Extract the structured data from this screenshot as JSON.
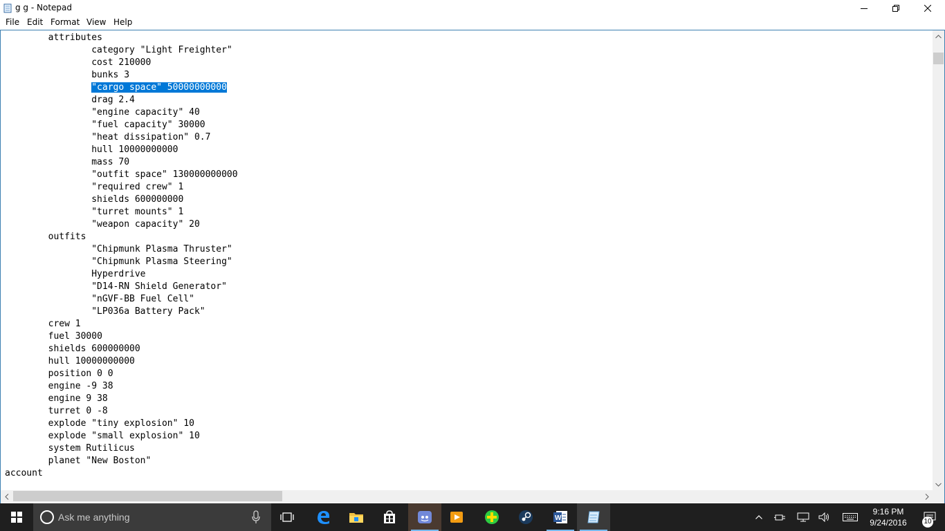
{
  "window": {
    "title": "g g - Notepad",
    "menu": [
      "File",
      "Edit",
      "Format",
      "View",
      "Help"
    ]
  },
  "editor": {
    "lines": [
      {
        "indent": "        ",
        "text": "attributes"
      },
      {
        "indent": "                ",
        "text": "category \"Light Freighter\""
      },
      {
        "indent": "                ",
        "text": "cost 210000"
      },
      {
        "indent": "                ",
        "text": "bunks 3"
      },
      {
        "indent": "                ",
        "text": "\"cargo space\" 50000000000",
        "selected": true
      },
      {
        "indent": "                ",
        "text": "drag 2.4"
      },
      {
        "indent": "                ",
        "text": "\"engine capacity\" 40"
      },
      {
        "indent": "                ",
        "text": "\"fuel capacity\" 30000"
      },
      {
        "indent": "                ",
        "text": "\"heat dissipation\" 0.7"
      },
      {
        "indent": "                ",
        "text": "hull 10000000000"
      },
      {
        "indent": "                ",
        "text": "mass 70"
      },
      {
        "indent": "                ",
        "text": "\"outfit space\" 130000000000"
      },
      {
        "indent": "                ",
        "text": "\"required crew\" 1"
      },
      {
        "indent": "                ",
        "text": "shields 600000000"
      },
      {
        "indent": "                ",
        "text": "\"turret mounts\" 1"
      },
      {
        "indent": "                ",
        "text": "\"weapon capacity\" 20"
      },
      {
        "indent": "        ",
        "text": "outfits"
      },
      {
        "indent": "                ",
        "text": "\"Chipmunk Plasma Thruster\""
      },
      {
        "indent": "                ",
        "text": "\"Chipmunk Plasma Steering\""
      },
      {
        "indent": "                ",
        "text": "Hyperdrive"
      },
      {
        "indent": "                ",
        "text": "\"D14-RN Shield Generator\""
      },
      {
        "indent": "                ",
        "text": "\"nGVF-BB Fuel Cell\""
      },
      {
        "indent": "                ",
        "text": "\"LP036a Battery Pack\""
      },
      {
        "indent": "        ",
        "text": "crew 1"
      },
      {
        "indent": "        ",
        "text": "fuel 30000"
      },
      {
        "indent": "        ",
        "text": "shields 600000000"
      },
      {
        "indent": "        ",
        "text": "hull 10000000000"
      },
      {
        "indent": "        ",
        "text": "position 0 0"
      },
      {
        "indent": "        ",
        "text": "engine -9 38"
      },
      {
        "indent": "        ",
        "text": "engine 9 38"
      },
      {
        "indent": "        ",
        "text": "turret 0 -8"
      },
      {
        "indent": "        ",
        "text": "explode \"tiny explosion\" 10"
      },
      {
        "indent": "        ",
        "text": "explode \"small explosion\" 10"
      },
      {
        "indent": "        ",
        "text": "system Rutilicus"
      },
      {
        "indent": "        ",
        "text": "planet \"New Boston\""
      },
      {
        "indent": "",
        "text": "account"
      }
    ]
  },
  "taskbar": {
    "search_placeholder": "Ask me anything",
    "apps": [
      {
        "name": "task-view",
        "icon": "task-view-icon"
      },
      {
        "name": "edge",
        "icon": "edge-icon"
      },
      {
        "name": "file-explorer",
        "icon": "folder-icon"
      },
      {
        "name": "store",
        "icon": "store-icon"
      },
      {
        "name": "discord",
        "icon": "discord-icon"
      },
      {
        "name": "media-player",
        "icon": "media-player-icon"
      },
      {
        "name": "plus-app",
        "icon": "plus-icon"
      },
      {
        "name": "steam",
        "icon": "steam-icon"
      },
      {
        "name": "word",
        "icon": "word-icon"
      },
      {
        "name": "notepad",
        "icon": "notepad-icon"
      }
    ],
    "clock_time": "9:16 PM",
    "clock_date": "9/24/2016",
    "notification_count": "10"
  },
  "colors": {
    "selection": "#0078d7",
    "taskbar": "#1f1f1f",
    "accent": "#76b9ed"
  }
}
